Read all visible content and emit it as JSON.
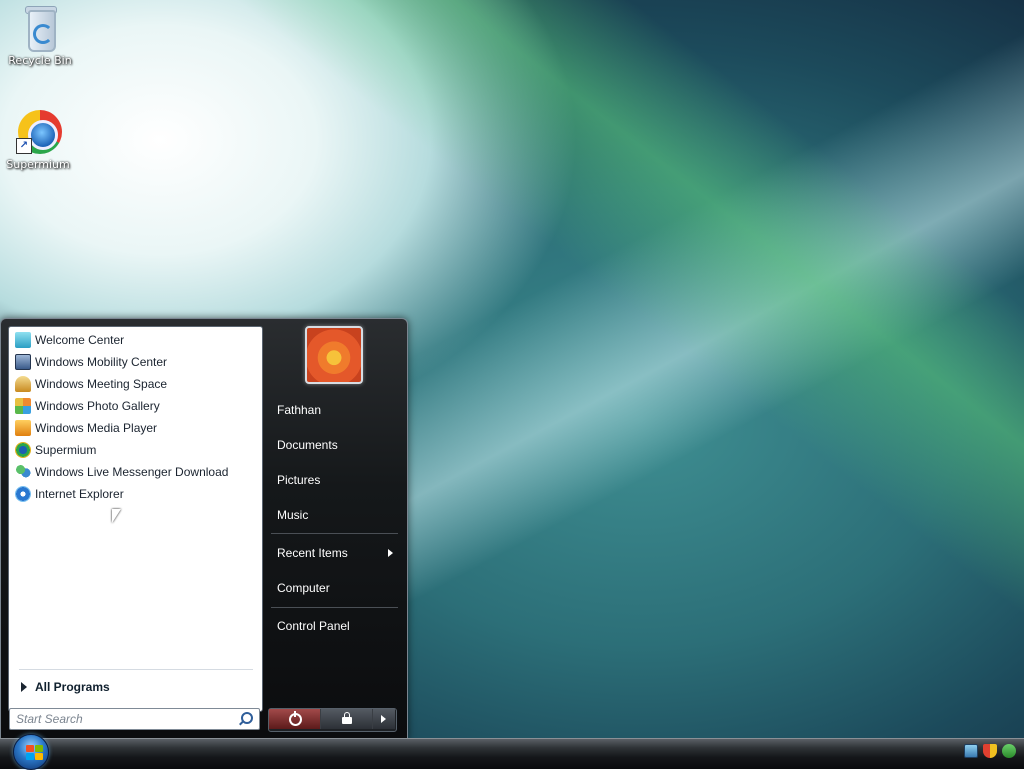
{
  "desktop": {
    "icons": [
      {
        "label": "Recycle Bin",
        "icon": "recycle-bin-icon"
      },
      {
        "label": "Supermium",
        "icon": "supermium-browser-icon"
      }
    ]
  },
  "start_menu": {
    "programs": [
      {
        "label": "Welcome Center",
        "icon": "welcome-center-icon",
        "color": "#3fb8d8"
      },
      {
        "label": "Windows Mobility Center",
        "icon": "mobility-center-icon",
        "color": "#4a6fa8"
      },
      {
        "label": "Windows Meeting Space",
        "icon": "meeting-space-icon",
        "color": "#d8a23a"
      },
      {
        "label": "Windows Photo Gallery",
        "icon": "photo-gallery-icon",
        "color": "#e07030"
      },
      {
        "label": "Windows Media Player",
        "icon": "media-player-icon",
        "color": "#f0a020"
      },
      {
        "label": "Supermium",
        "icon": "supermium-icon",
        "color": "#2a9a6a"
      },
      {
        "label": "Windows Live Messenger Download",
        "icon": "messenger-icon",
        "color": "#3a9a4a"
      },
      {
        "label": "Internet Explorer",
        "icon": "internet-explorer-icon",
        "color": "#2a78d0"
      }
    ],
    "all_programs": "All Programs",
    "search_placeholder": "Start Search",
    "user_name": "Fathhan",
    "right_items": {
      "documents": "Documents",
      "pictures": "Pictures",
      "music": "Music",
      "recent_items": "Recent Items",
      "computer": "Computer",
      "control_panel": "Control Panel"
    }
  },
  "taskbar": {
    "start_button": "start-orb-icon",
    "tray_icons": [
      "network-icon",
      "security-shield-icon",
      "update-icon"
    ]
  }
}
